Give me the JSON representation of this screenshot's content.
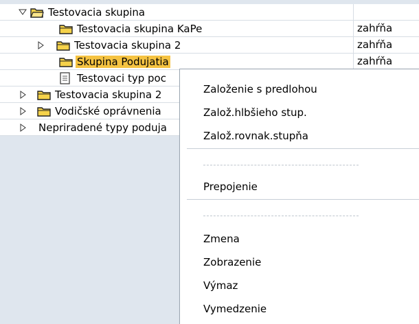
{
  "tree": {
    "rows": [
      {
        "label": "Testovacia skupina",
        "col2": "",
        "expander": "open",
        "icon": "folder-open-icon"
      },
      {
        "label": "Testovacia skupina KaPe",
        "col2": "zahŕňa",
        "expander": "none",
        "icon": "folder-icon"
      },
      {
        "label": "Testovacia skupina 2",
        "col2": "zahŕňa",
        "expander": "closed",
        "icon": "folder-icon"
      },
      {
        "label": "Skupina Podujatia",
        "col2": "zahŕňa",
        "expander": "none",
        "icon": "folder-icon",
        "selected": true
      },
      {
        "label": "Testovaci typ poc",
        "col2": "",
        "expander": "none",
        "icon": "document-icon"
      },
      {
        "label": "Testovacia skupina 2",
        "col2": "",
        "expander": "closed",
        "icon": "folder-icon"
      },
      {
        "label": "Vodičské oprávnenia",
        "col2": "",
        "expander": "closed",
        "icon": "folder-icon"
      },
      {
        "label": "Nepriradené typy poduja",
        "col2": "",
        "expander": "closed",
        "icon": "none"
      }
    ]
  },
  "context_menu": {
    "items": {
      "zalozenie_s_predlohou": "Založenie s predlohou",
      "zaloz_hlbsieho": "Založ.hlbšieho stup.",
      "zaloz_rovnak": "Založ.rovnak.stupňa",
      "prepojenie": "Prepojenie",
      "zmena": "Zmena",
      "zobrazenie": "Zobrazenie",
      "vymaz": "Výmaz",
      "vymedzenie": "Vymedzenie"
    }
  },
  "colors": {
    "selection": "#f5c342",
    "background": "#dfe6ee",
    "folder": "#f5d24a"
  }
}
